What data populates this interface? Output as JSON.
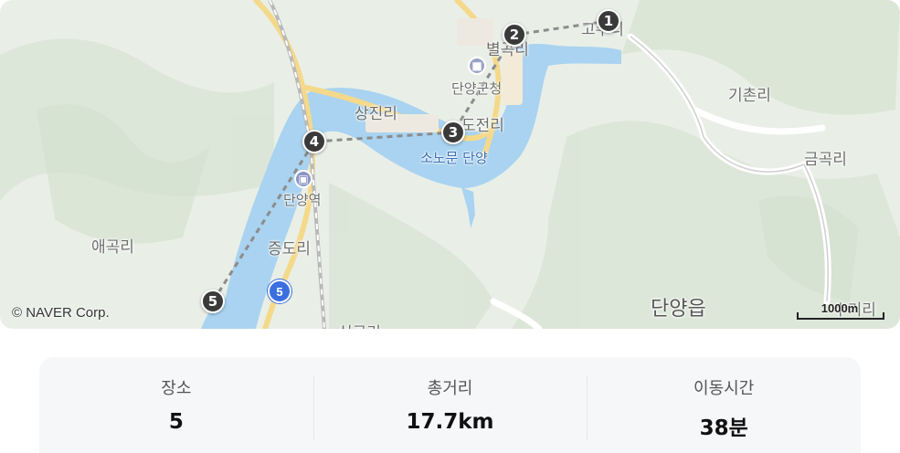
{
  "map": {
    "copyright": "© NAVER Corp.",
    "scale_label": "1000m",
    "route_number": "5",
    "colors": {
      "land": "#e9efe7",
      "water": "#a9d3f0",
      "road": "#f5d98a",
      "route_line": "#888888",
      "marker": "#3a3a3a"
    },
    "places": [
      {
        "id": "byeolgok",
        "name": "별곡리"
      },
      {
        "id": "danyang-county",
        "name": "단양군청"
      },
      {
        "id": "sangjin",
        "name": "상진리"
      },
      {
        "id": "dojeon",
        "name": "도전리"
      },
      {
        "id": "sonobun",
        "name": "소노문 단양"
      },
      {
        "id": "danyang-station",
        "name": "단양역"
      },
      {
        "id": "aegok",
        "name": "애곡리"
      },
      {
        "id": "jeungdo",
        "name": "증도리"
      },
      {
        "id": "gichon",
        "name": "기촌리"
      },
      {
        "id": "geumgok",
        "name": "금곡리"
      },
      {
        "id": "danyang-eup",
        "name": "단양읍"
      },
      {
        "id": "gosu",
        "name": "고수리"
      },
      {
        "id": "simgok",
        "name": "심곡리"
      },
      {
        "id": "sugi",
        "name": "수기리"
      }
    ],
    "markers": [
      {
        "number": "1"
      },
      {
        "number": "2"
      },
      {
        "number": "3"
      },
      {
        "number": "4"
      },
      {
        "number": "5"
      }
    ]
  },
  "summary": {
    "items": [
      {
        "label": "장소",
        "value": "5"
      },
      {
        "label": "총거리",
        "value": "17.7km"
      },
      {
        "label": "이동시간",
        "value": "38분"
      }
    ]
  }
}
